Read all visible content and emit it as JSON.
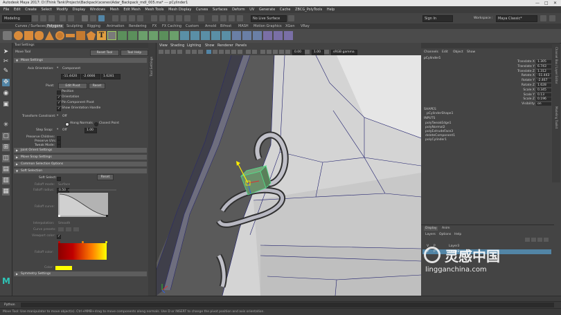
{
  "window": {
    "title": "Autodesk Maya 2017: D:\\Think Tank\\Projects\\Backpack\\scenes\\Adar_Backpack_mdl_005.ma*  ---  pCylinder1",
    "controls": [
      "—",
      "□",
      "✕"
    ]
  },
  "menubar": [
    "File",
    "Edit",
    "Create",
    "Select",
    "Modify",
    "Display",
    "Windows",
    "Mesh",
    "Edit Mesh",
    "Mesh Tools",
    "Mesh Display",
    "Curves",
    "Surfaces",
    "Deform",
    "UV",
    "Generate",
    "Cache",
    "ZBCG_PolyTools",
    "Help"
  ],
  "statusline": {
    "mode": "Modeling",
    "live_surface": "No Live Surface",
    "sign_in": "Sign In",
    "workspace_label": "Workspace :",
    "workspace": "Maya Classic*"
  },
  "shelf_tabs": [
    {
      "label": "Curves / Surfaces",
      "active": false
    },
    {
      "label": "Polygons",
      "active": true
    },
    {
      "label": "Sculpting",
      "active": false
    },
    {
      "label": "Rigging",
      "active": false
    },
    {
      "label": "Animation",
      "active": false
    },
    {
      "label": "Rendering",
      "active": false
    },
    {
      "label": "FX",
      "active": false
    },
    {
      "label": "FX Caching",
      "active": false
    },
    {
      "label": "Custom",
      "active": false
    },
    {
      "label": "Arnold",
      "active": false
    },
    {
      "label": "Bifrost",
      "active": false
    },
    {
      "label": "MASH",
      "active": false
    },
    {
      "label": "Motion Graphics",
      "active": false
    },
    {
      "label": "XGen",
      "active": false
    },
    {
      "label": "VRay",
      "active": false
    }
  ],
  "tool_settings": {
    "panel_title": "Tool Settings",
    "tool_name": "Move Tool",
    "reset_tool": "Reset Tool",
    "tool_help": "Tool Help",
    "move_settings": "Move Settings",
    "axis_orientation_label": "Axis Orientation:",
    "axis_orientation_value": "Component",
    "xyz": [
      "-11.4420",
      "-2.6666",
      "1.6281"
    ],
    "pivot_label": "Pivot:",
    "edit_pivot": "Edit Pivot",
    "reset": "Reset",
    "checks": [
      {
        "label": "Position",
        "on": false
      },
      {
        "label": "Orientation",
        "on": true
      },
      {
        "label": "Pin Component Pivot",
        "on": true
      },
      {
        "label": "Show Orientation Handle",
        "on": true
      }
    ],
    "transform_constraint_label": "Transform Constraint:",
    "transform_constraint_value": "Off",
    "along_normals": "Along Normals",
    "closest_point": "Closest Point",
    "step_snap_label": "Step Snap:",
    "step_snap_value": "Off",
    "step_snap_amount": "1.00",
    "preserve_children": "Preserve Children:",
    "preserve_uvs": "Preserve UVs:",
    "tweak_mode": "Tweak Mode:",
    "sections": [
      "Joint Orient Settings",
      "Move Snap Settings",
      "Common Selection Options",
      "Soft Selection"
    ],
    "soft_select_label": "Soft Select:",
    "soft_reset": "Reset",
    "falloff_mode_label": "Falloff mode:",
    "falloff_mode_value": "Surface",
    "falloff_radius_label": "Falloff radius:",
    "falloff_radius_value": "0.50",
    "falloff_curve_label": "Falloff curve:",
    "interpolation_label": "Interpolation:",
    "interpolation_value": "Smooth",
    "curve_presets_label": "Curve presets:",
    "viewport_color_label": "Viewport color:",
    "falloff_color_label": "Falloff color:",
    "color_label": "Color:",
    "symmetry_settings": "Symmetry Settings"
  },
  "side_strips": {
    "tool_settings_vertical": "Tool Settings",
    "attribute_editor_vertical": "Channel Box / Layer Editor",
    "modeling_toolkit_vertical": "Modeling Toolkit"
  },
  "viewport": {
    "menu": [
      "View",
      "Shading",
      "Lighting",
      "Show",
      "Renderer",
      "Panels"
    ],
    "field_a": "0.00",
    "field_b": "1.00",
    "colorspace": "sRGB gamma"
  },
  "channel_box": {
    "tabs": [
      "Channels",
      "Edit",
      "Object",
      "Show"
    ],
    "object": "pCylinder1",
    "attrs": [
      {
        "name": "Translate X",
        "value": "1.305"
      },
      {
        "name": "Translate Y",
        "value": "6.743"
      },
      {
        "name": "Translate Z",
        "value": "1.312"
      },
      {
        "name": "Rotate X",
        "value": "-51.443"
      },
      {
        "name": "Rotate Y",
        "value": "-2.467"
      },
      {
        "name": "Rotate Z",
        "value": "1.628"
      },
      {
        "name": "Scale X",
        "value": "0.345"
      },
      {
        "name": "Scale Y",
        "value": "0.13"
      },
      {
        "name": "Scale Z",
        "value": "0.196"
      },
      {
        "name": "Visibility",
        "value": "on"
      }
    ],
    "shapes_header": "SHAPES",
    "shape": "pCylinderShape1",
    "inputs_header": "INPUTS",
    "inputs": [
      "polyTweakEdge1",
      "polyNormal2",
      "polyExtrudeFace3",
      "deleteComponent1",
      "polyCylinder1"
    ]
  },
  "layer_editor": {
    "tabs": [
      "Display",
      "Anim"
    ],
    "menu": [
      "Layers",
      "Options",
      "Help"
    ],
    "layers": [
      {
        "v": "V",
        "p": "P",
        "name": "Layer3",
        "selected": false
      },
      {
        "v": "V",
        "p": "P",
        "name": "Layer2",
        "selected": true
      }
    ]
  },
  "cmdline": {
    "lang": "Python"
  },
  "helpline": "Move Tool: Use manipulator to move object(s). Ctrl+MMB+drag to move components along normals. Use D or INSERT to change the pivot position and axis orientation.",
  "watermark": {
    "cn": "灵感中国",
    "url": "lingganchina.com"
  },
  "colors": {
    "accent": "#5285a6",
    "selected_object": "#4ee08a",
    "soft_gradient_start": "#c00000",
    "soft_gradient_end": "#ffff00"
  }
}
